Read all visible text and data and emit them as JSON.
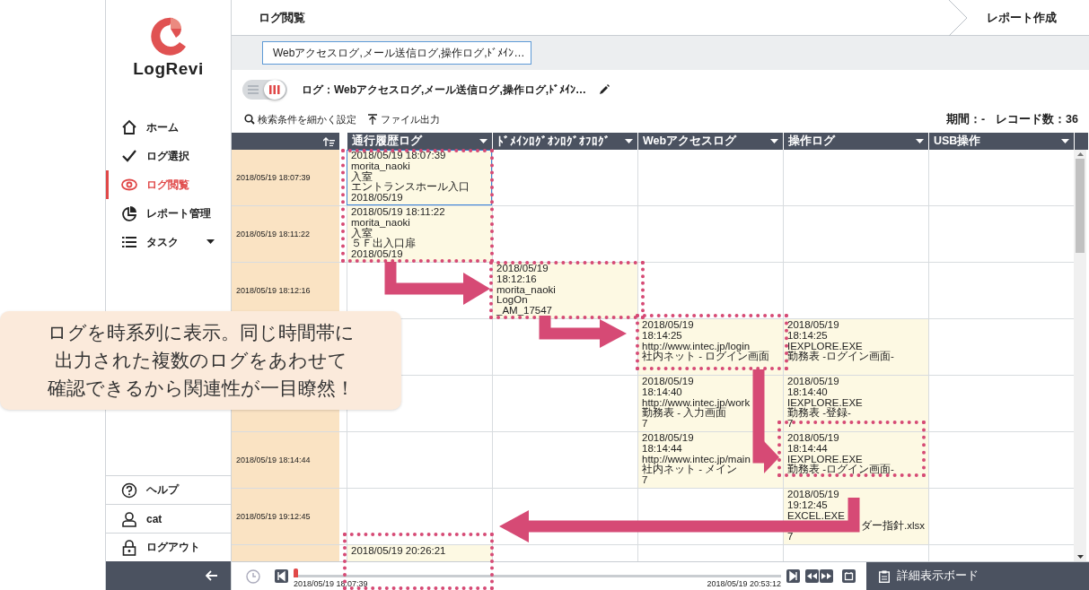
{
  "sidebar": {
    "logo": "LogRevi",
    "nav": [
      {
        "label": "ホーム",
        "selected": false
      },
      {
        "label": "ログ選択",
        "selected": false
      },
      {
        "label": "ログ閲覧",
        "selected": true
      },
      {
        "label": "レポート管理",
        "selected": false
      },
      {
        "label": "タスク",
        "selected": false,
        "expandable": true
      }
    ],
    "footer": [
      {
        "label": "ヘルプ"
      },
      {
        "label": "cat"
      },
      {
        "label": "ログアウト"
      }
    ]
  },
  "header": {
    "title": "ログ閲覧",
    "step": "レポート作成"
  },
  "filter": {
    "value": "Webアクセスログ,メール送信ログ,操作ログ,ﾄﾞﾒｲﾝ…"
  },
  "view_toggle": [
    {
      "selected": false
    },
    {
      "selected": true
    }
  ],
  "log_title": "ログ：Webアクセスログ,メール送信ログ,操作ログ,ﾄﾞﾒｲﾝ…",
  "tools": [
    "検索条件を細かく設定",
    "ファイル出力"
  ],
  "summary": {
    "period": "期間：-",
    "records": "レコード数：36"
  },
  "table": {
    "columns": [
      "通行履歴ログ",
      "ﾄﾞﾒｲﾝﾛｸﾞｵﾝﾛｸﾞｵﾌﾛｸﾞ",
      "Webアクセスログ",
      "操作ログ",
      "USB操作"
    ],
    "rows": [
      {
        "time": "2018/05/19 18:07:39",
        "cells": [
          {
            "selected": true,
            "lines": [
              "2018/05/19 18:07:39",
              "morita_naoki",
              "入室",
              "エントランスホール入口",
              "2018/05/19"
            ]
          },
          null,
          null,
          null,
          null
        ]
      },
      {
        "time": "2018/05/19 18:11:22",
        "cells": [
          {
            "selected": false,
            "lines": [
              "2018/05/19 18:11:22",
              "morita_naoki",
              "入室",
              "５Ｆ出入口扉",
              "2018/05/19"
            ]
          },
          null,
          null,
          null,
          null
        ]
      },
      {
        "time": "2018/05/19 18:12:16",
        "cells": [
          null,
          {
            "selected": false,
            "lines": [
              "2018/05/19",
              "18:12:16",
              "morita_naoki",
              "LogOn",
              "_AM_17547"
            ]
          },
          null,
          null,
          null
        ]
      },
      {
        "cells": [
          null,
          null,
          {
            "selected": false,
            "lines": [
              "2018/05/19",
              "18:14:25",
              "http://www.intec.jp/login",
              "社内ネット - ログイン画面"
            ]
          },
          {
            "selected": false,
            "lines": [
              "2018/05/19",
              "18:14:25",
              "IEXPLORE.EXE",
              "勤務表 -ログイン画面-"
            ]
          },
          null
        ]
      },
      {
        "cells": [
          null,
          null,
          {
            "selected": false,
            "lines": [
              "2018/05/19",
              "18:14:40",
              "http://www.intec.jp/work",
              "勤務表 - 入力画面",
              "7"
            ]
          },
          {
            "selected": false,
            "lines": [
              "2018/05/19",
              "18:14:40",
              "IEXPLORE.EXE",
              "勤務表 -登録-",
              "7"
            ]
          },
          null
        ]
      },
      {
        "time": "2018/05/19 18:14:44",
        "cells": [
          null,
          null,
          {
            "selected": false,
            "lines": [
              "2018/05/19",
              "18:14:44",
              "http://www.intec.jp/main",
              "社内ネット - メイン",
              "7"
            ]
          },
          {
            "selected": false,
            "lines": [
              "2018/05/19",
              "18:14:44",
              "IEXPLORE.EXE",
              "勤務表 -ログイン画面-"
            ]
          },
          null
        ]
      },
      {
        "time": "2018/05/19 19:12:45",
        "cells": [
          null,
          null,
          null,
          {
            "selected": false,
            "lines": [
              "2018/05/19",
              "19:12:45",
              "EXCEL.EXE",
              {
                "text": "ダー指針.xlsx",
                "covered": true
              },
              "7"
            ]
          },
          null
        ]
      },
      {
        "cells": [
          {
            "selected": false,
            "lines": [
              "2018/05/19 20:26:21"
            ]
          },
          null,
          null,
          null,
          null
        ]
      }
    ]
  },
  "timeline": {
    "start": "2018/05/19 18:07:39",
    "end": "2018/05/19 20:53:12",
    "level": 0
  },
  "board_button": "詳細表示ボード",
  "callout": [
    "ログを時系列に表示。同じ時間帯に",
    "出力された複数のログをあわせて",
    "確認できるから関連性が一目瞭然！"
  ]
}
